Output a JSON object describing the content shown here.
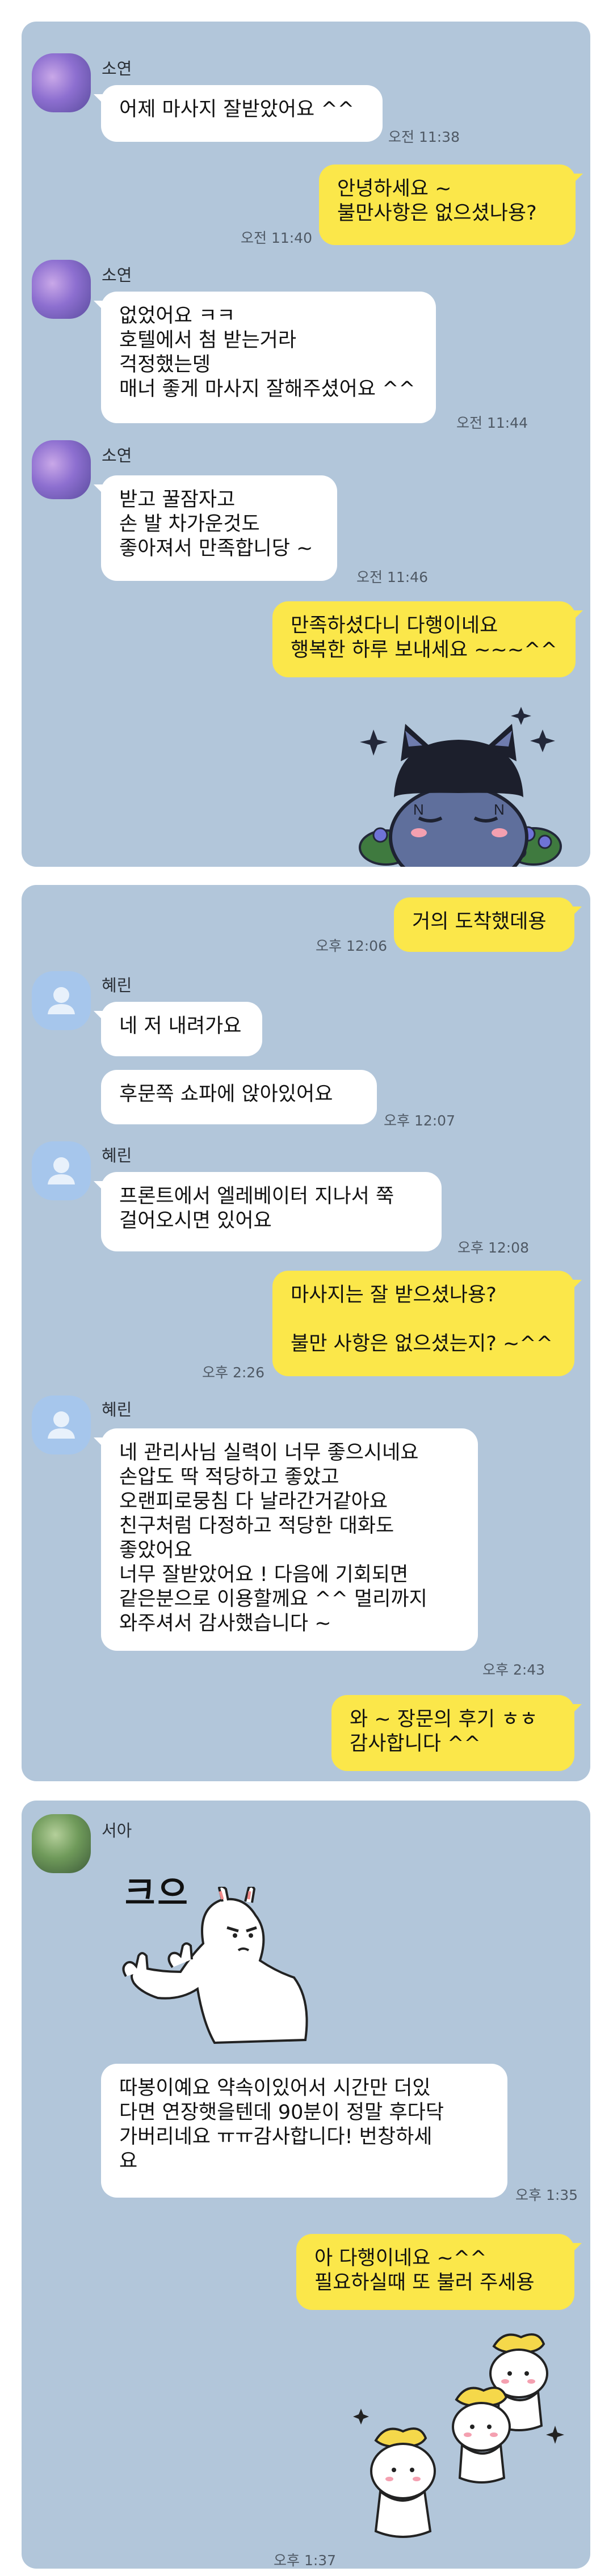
{
  "panel1": {
    "messages": [
      {
        "sender": "소연",
        "text": "어제 마사지 잘받았어요 ^^",
        "time": "오전 11:38"
      },
      {
        "text": "안녕하세요 ~\n불만사항은 없으셨나용?",
        "time": "오전 11:40"
      },
      {
        "sender": "소연",
        "text": "없었어요 ㅋㅋ\n호텔에서 첨 받는거라\n걱정했는뎅\n매너 좋게 마사지 잘해주셨어요 ^^",
        "time": "오전 11:44"
      },
      {
        "sender": "소연",
        "text": "받고 꿀잠자고\n손 발 차가운것도\n좋아져서 만족합니당 ~",
        "time": "오전 11:46"
      },
      {
        "text": "만족하셨다니 다행이네요\n행복한 하루 보내세요 ~~~^^"
      }
    ]
  },
  "panel2": {
    "messages": [
      {
        "text": "거의 도착했데용",
        "time": "오후 12:06"
      },
      {
        "sender": "혜린",
        "text": "네 저 내려가요"
      },
      {
        "text": "후문쪽 쇼파에 앉아있어요",
        "time": "오후 12:07"
      },
      {
        "sender": "혜린",
        "text": "프론트에서 엘레베이터 지나서 쭉\n걸어오시면 있어요",
        "time": "오후 12:08"
      },
      {
        "text": "마사지는 잘 받으셨나용?\n\n불만 사항은 없으셨는지? ~^^",
        "time": "오후 2:26"
      },
      {
        "sender": "혜린",
        "text": "네 관리사님 실력이 너무 좋으시네요\n손압도 딱 적당하고 좋았고\n오랜피로뭉침 다 날라간거같아요\n친구처럼 다정하고 적당한 대화도\n좋았어요\n너무 잘받았어요 ! 다음에 기회되면\n같은분으로 이용할께요 ^^ 멀리까지\n와주셔서 감사했습니다 ~",
        "time": "오후 2:43"
      },
      {
        "text": "와 ~ 장문의 후기 ㅎㅎ\n감사합니다 ^^"
      }
    ]
  },
  "panel3": {
    "messages": [
      {
        "sender": "서아",
        "sticker_text": "크으"
      },
      {
        "text": "따봉이예요 약속이있어서 시간만 더있\n다면 연장햇을텐데 90분이 정말 후다닥\n가버리네요 ㅠㅠ감사합니다! 번창하세\n요",
        "time": "오후 1:35"
      },
      {
        "text": "아 다행이네요 ~^^\n필요하실때 또 불러 주세용"
      },
      {
        "time": "오후 1:37"
      }
    ]
  },
  "colors": {
    "chat_background": "#b2c6da",
    "my_bubble": "#fbe74a",
    "other_bubble": "#ffffff"
  }
}
